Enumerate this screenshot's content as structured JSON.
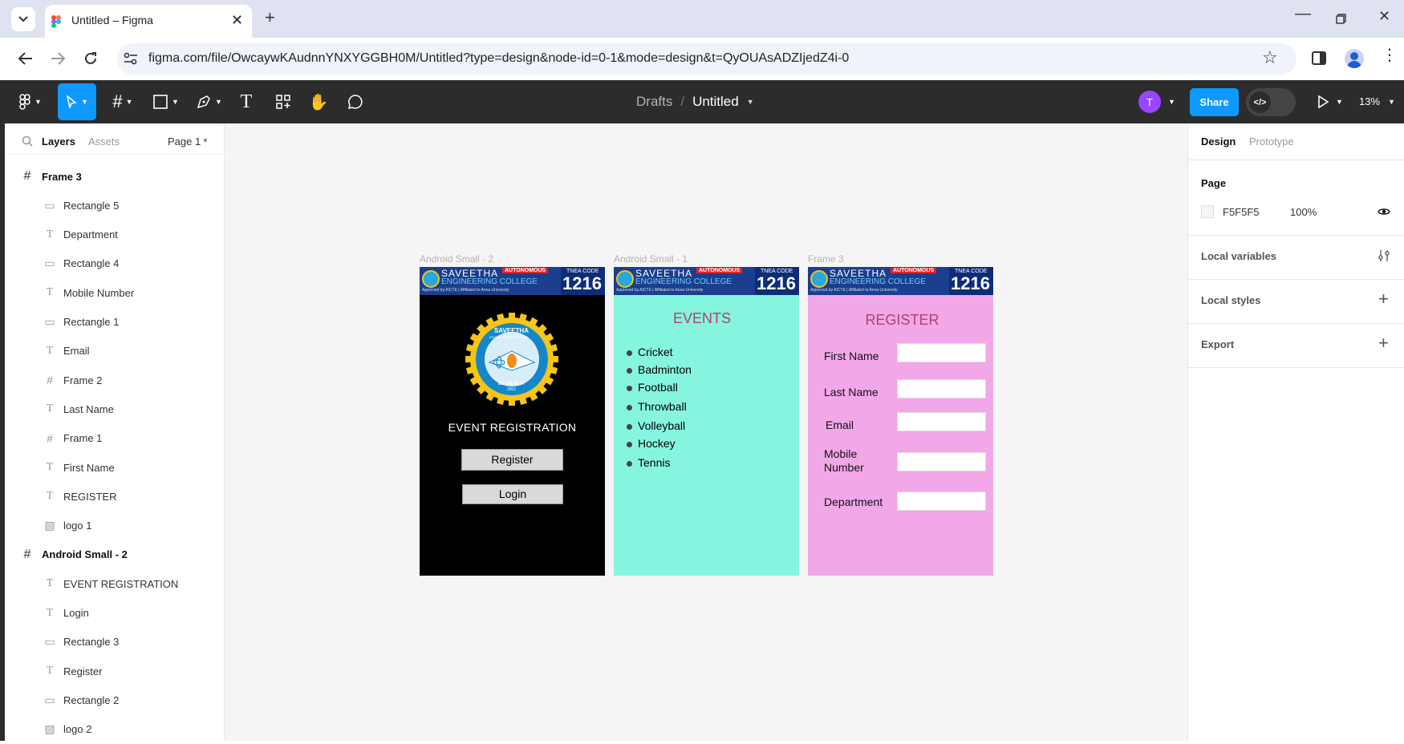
{
  "browser": {
    "tab_title": "Untitled – Figma",
    "url": "figma.com/file/OwcaywKAudnnYNXYGGBH0M/Untitled?type=design&node-id=0-1&mode=design&t=QyOUAsADZIjedZ4i-0"
  },
  "toolbar": {
    "breadcrumb_parent": "Drafts",
    "breadcrumb_sep": "/",
    "file_name": "Untitled",
    "avatar_initial": "T",
    "share_label": "Share",
    "zoom": "13%"
  },
  "left_panel": {
    "tab_layers": "Layers",
    "tab_assets": "Assets",
    "page_selector": "Page 1",
    "layers": [
      {
        "name": "Frame 3",
        "type": "frame",
        "depth": 0
      },
      {
        "name": "Rectangle 5",
        "type": "rect",
        "depth": 1
      },
      {
        "name": "Department",
        "type": "text",
        "depth": 1
      },
      {
        "name": "Rectangle 4",
        "type": "rect",
        "depth": 1
      },
      {
        "name": "Mobile Number",
        "type": "text",
        "depth": 1
      },
      {
        "name": "Rectangle 1",
        "type": "rect",
        "depth": 1
      },
      {
        "name": "Email",
        "type": "text",
        "depth": 1
      },
      {
        "name": "Frame 2",
        "type": "frame",
        "depth": 1
      },
      {
        "name": "Last Name",
        "type": "text",
        "depth": 1
      },
      {
        "name": "Frame 1",
        "type": "frame",
        "depth": 1
      },
      {
        "name": "First Name",
        "type": "text",
        "depth": 1
      },
      {
        "name": "REGISTER",
        "type": "text",
        "depth": 1
      },
      {
        "name": "logo 1",
        "type": "image",
        "depth": 1
      },
      {
        "name": "Android Small - 2",
        "type": "frame",
        "depth": 0
      },
      {
        "name": "EVENT REGISTRATION",
        "type": "text",
        "depth": 1
      },
      {
        "name": "Login",
        "type": "text",
        "depth": 1
      },
      {
        "name": "Rectangle 3",
        "type": "rect",
        "depth": 1
      },
      {
        "name": "Register",
        "type": "text",
        "depth": 1
      },
      {
        "name": "Rectangle 2",
        "type": "rect",
        "depth": 1
      },
      {
        "name": "logo 2",
        "type": "image",
        "depth": 1
      }
    ]
  },
  "right_panel": {
    "tab_design": "Design",
    "tab_prototype": "Prototype",
    "page_heading": "Page",
    "page_color": "F5F5F5",
    "page_opacity": "100%",
    "local_variables": "Local variables",
    "local_styles": "Local styles",
    "export": "Export"
  },
  "canvas": {
    "frames": {
      "android2_label": "Android Small - 2",
      "android1_label": "Android Small - 1",
      "frame3_label": "Frame 3"
    },
    "banner": {
      "college_line1": "SAVEETHA",
      "college_line2": "ENGINEERING COLLEGE",
      "autonomous": "AUTONOMOUS",
      "approval": "Approved by AICTE | Affiliated to Anna University",
      "tnea": "TNEA CODE",
      "code": "1216"
    },
    "logo": {
      "top_text": "SAVEETHA",
      "sub_text": "ENGINEERING COLLEGE",
      "motto": "BE THE BEST",
      "year": "2001"
    },
    "home": {
      "heading": "EVENT REGISTRATION",
      "register_btn": "Register",
      "login_btn": "Login"
    },
    "events": {
      "heading": "EVENTS",
      "items": [
        "Cricket",
        "Badminton",
        "Football",
        "Throwball",
        "Volleyball",
        "Hockey",
        "Tennis"
      ]
    },
    "register": {
      "heading": "REGISTER",
      "first_name": "First Name",
      "last_name": "Last Name",
      "email": "Email",
      "mobile_line1": "Mobile",
      "mobile_line2": "Number",
      "department": "Department"
    }
  },
  "help_label": "?",
  "colors": {
    "toolbar_bg": "#2c2c2c",
    "accent_blue": "#0d99ff",
    "avatar_purple": "#9747ff",
    "events_bg": "#86f5df",
    "register_bg": "#f2a7e8",
    "banner_blue": "#1b3e8e"
  }
}
